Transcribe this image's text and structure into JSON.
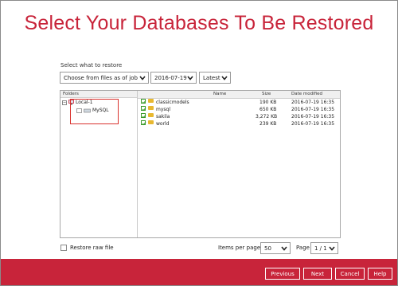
{
  "title": "Select Your Databases To Be Restored",
  "select_label": "Select what to restore",
  "filters": {
    "mode": "Choose from files as of job",
    "date": "2016-07-19",
    "version": "Latest"
  },
  "tree": {
    "header": "Folders",
    "root": "Local-1",
    "child": "MySQL",
    "expand_glyph": "−"
  },
  "list": {
    "headers": {
      "name": "Name",
      "size": "Size",
      "modified": "Date modified"
    },
    "rows": [
      {
        "name": "classicmodels",
        "size": "190 KB",
        "modified": "2016-07-19 16:35"
      },
      {
        "name": "mysql",
        "size": "650 KB",
        "modified": "2016-07-19 16:35"
      },
      {
        "name": "sakila",
        "size": "3,272 KB",
        "modified": "2016-07-19 16:35"
      },
      {
        "name": "world",
        "size": "239 KB",
        "modified": "2016-07-19 16:35"
      }
    ]
  },
  "restore_raw": "Restore raw file",
  "paging": {
    "items_label": "Items per page",
    "items_value": "50",
    "page_label": "Page",
    "page_value": "1 / 1"
  },
  "buttons": {
    "previous": "Previous",
    "next": "Next",
    "cancel": "Cancel",
    "help": "Help"
  },
  "colors": {
    "accent": "#c8243a",
    "highlight": "#d9322e",
    "check": "#3a9a2a",
    "folder": "#e8b830"
  }
}
